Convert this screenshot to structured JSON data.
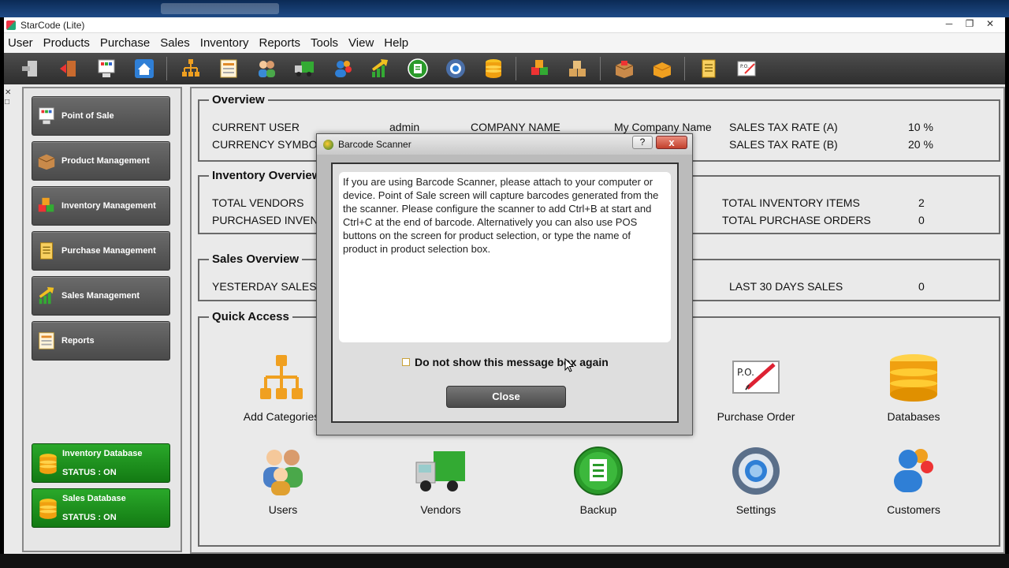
{
  "window": {
    "title": "StarCode (Lite)"
  },
  "menu": [
    "User",
    "Products",
    "Purchase",
    "Sales",
    "Inventory",
    "Reports",
    "Tools",
    "View",
    "Help"
  ],
  "toolbar": {
    "icons": [
      "exit-icon",
      "logout-icon",
      "pos-icon",
      "home-icon",
      "categories-icon",
      "reports-icon",
      "users-icon",
      "vendors-icon",
      "customers-icon",
      "sales-icon",
      "backup-icon",
      "settings-icon",
      "database-icon",
      "inventory-icon",
      "products-icon",
      "receive-icon",
      "open-box-icon",
      "purchase-icon",
      "purchase-order-icon"
    ]
  },
  "sidebar": {
    "items": [
      {
        "label": "Point of Sale",
        "icon": "pos-icon"
      },
      {
        "label": "Product Management",
        "icon": "products-icon"
      },
      {
        "label": "Inventory Management",
        "icon": "inventory-icon"
      },
      {
        "label": "Purchase Management",
        "icon": "purchase-icon"
      },
      {
        "label": "Sales Management",
        "icon": "sales-icon"
      },
      {
        "label": "Reports",
        "icon": "reports-icon"
      }
    ],
    "databases": [
      {
        "label": "Inventory Database",
        "status": "STATUS : ON"
      },
      {
        "label": "Sales Database",
        "status": "STATUS : ON"
      }
    ]
  },
  "overview": {
    "legend": "Overview",
    "current_user_label": "CURRENT USER",
    "current_user": "admin",
    "company_name_label": "COMPANY NAME",
    "company_name": "My Company Name",
    "sales_tax_a_label": "SALES TAX RATE (A)",
    "sales_tax_a": "10 %",
    "currency_symbol_label": "CURRENCY SYMBOL",
    "sales_tax_b_label": "SALES TAX RATE (B)",
    "sales_tax_b": "20 %"
  },
  "inventory_overview": {
    "legend": "Inventory Overview",
    "total_vendors_label": "TOTAL VENDORS",
    "purchased_inventory_label": "PURCHASED INVENTO",
    "total_inventory_items_label": "TOTAL INVENTORY ITEMS",
    "total_inventory_items": "2",
    "total_purchase_orders_label": "TOTAL PURCHASE ORDERS",
    "total_purchase_orders": "0"
  },
  "sales_overview": {
    "legend": "Sales Overview",
    "yesterday_sales_label": "YESTERDAY SALES",
    "last_30_label": "LAST 30 DAYS SALES",
    "last_30": "0"
  },
  "quick_access": {
    "legend": "Quick Access",
    "items": [
      "Add Categories",
      "Purchase Order",
      "Databases",
      "Users",
      "Vendors",
      "Backup",
      "Settings",
      "Customers"
    ]
  },
  "dialog": {
    "title": "Barcode Scanner",
    "help": "?",
    "close_x": "x",
    "message": "If you are using Barcode Scanner, please attach to your computer or device. Point of Sale screen will capture barcodes generated from the the scanner. Please configure the scanner to add Ctrl+B at start and Ctrl+C at the end of barcode. Alternatively you can also use POS buttons on the screen for product selection, or type the name of product  in product selection box.",
    "checkbox_label": "Do not show this message box again",
    "close_label": "Close"
  },
  "colors": {
    "sidebar_button": "#5a5a5a",
    "db_button": "#1f9a1f",
    "toolbar": "#3c3c3c"
  }
}
